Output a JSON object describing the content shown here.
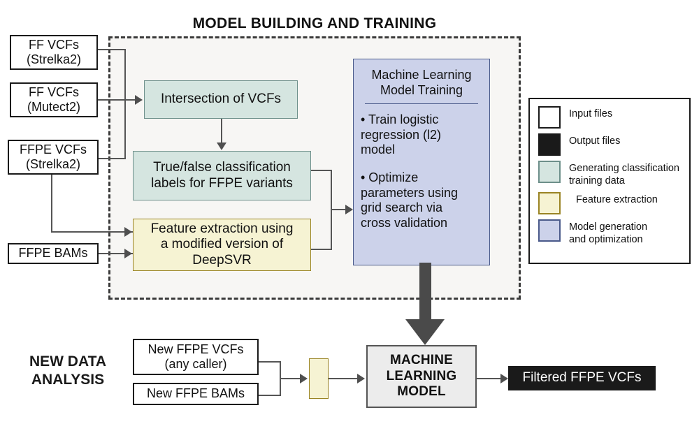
{
  "diagram": {
    "title": "MODEL BUILDING AND TRAINING",
    "new_data_label": "NEW DATA\nANALYSIS"
  },
  "inputs": {
    "ff_vcfs_strelka2": "FF VCFs\n(Strelka2)",
    "ff_vcfs_mutect2": "FF VCFs\n(Mutect2)",
    "ffpe_vcfs_strelka2": "FFPE VCFs\n(Strelka2)",
    "ffpe_bams": "FFPE BAMs",
    "new_ffpe_vcfs": "New FFPE VCFs\n(any caller)",
    "new_ffpe_bams": "New FFPE BAMs"
  },
  "processes": {
    "intersection": "Intersection of VCFs",
    "labels": "True/false classification\nlabels for FFPE variants",
    "feature_extraction": "Feature extraction using\na modified version of\nDeepSVR",
    "ml_model": "MACHINE\nLEARNING\nMODEL"
  },
  "ml_training": {
    "title": "Machine Learning\nModel Training",
    "bullets": [
      "• Train logistic\nregression (l2)\nmodel",
      "• Optimize\nparameters using\ngrid search via\ncross validation"
    ]
  },
  "outputs": {
    "filtered_ffpe_vcfs": "Filtered FFPE VCFs"
  },
  "legend": {
    "items": [
      {
        "label": "Input files",
        "fill": "#ffffff",
        "border": "#1a1a1a"
      },
      {
        "label": "Output files",
        "fill": "#1a1a1a",
        "border": "#1a1a1a"
      },
      {
        "label": "Generating classification\ntraining data",
        "fill": "#d5e5e0",
        "border": "#6d8f8a"
      },
      {
        "label": "Feature extraction",
        "fill": "#f6f3d3",
        "border": "#9a8424"
      },
      {
        "label": "Model generation\nand optimization",
        "fill": "#ccd2ea",
        "border": "#4a5a8a"
      }
    ]
  },
  "colors": {
    "teal_fill": "#d5e5e0",
    "teal_border": "#6d8f8a",
    "cream_fill": "#f6f3d3",
    "cream_border": "#9a8424",
    "lavender_fill": "#ccd2ea",
    "lavender_border": "#4a5a8a",
    "grey_fill": "#ececec",
    "black_fill": "#1a1a1a",
    "connector": "#4f4f4f",
    "region_fill": "#f7f6f4"
  }
}
